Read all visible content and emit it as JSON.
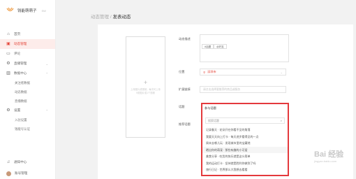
{
  "app": {
    "title": "钱能萌萌子",
    "badge": "SW"
  },
  "sidebar": {
    "items": [
      {
        "label": "首页",
        "icon": "home-icon"
      },
      {
        "label": "动态管理",
        "icon": "camera-icon"
      },
      {
        "label": "评论",
        "icon": "comment-icon"
      },
      {
        "label": "直播管理",
        "icon": "gear-icon"
      },
      {
        "label": "数据中心",
        "icon": "chart-icon"
      }
    ],
    "data_sub": [
      "关注者数据",
      "动态数据",
      "直播数据"
    ],
    "settings": {
      "label": "设置",
      "icon": "gear-icon"
    },
    "settings_sub": [
      "入驻设置",
      "钱能号认证"
    ],
    "bottom": [
      {
        "label": "通知中心",
        "icon": "bell-icon"
      },
      {
        "label": "账号管理",
        "icon": "avatar"
      }
    ]
  },
  "breadcrumb": {
    "parent": "动态管理",
    "separator": "/",
    "current": "发表动态"
  },
  "upload": {
    "plus": "+",
    "hint": "上传图片或视频，每次可上传9张图片或1个视频"
  },
  "form": {
    "desc_label": "动态描述",
    "tag_button_1": "#话题",
    "tag_button_2": "@好友",
    "location_label": "位置",
    "location_value": "深圳市",
    "extended_label": "扩展链接",
    "extended_placeholder": "请点击选择要推荐的商品或服务",
    "topic_label": "话题",
    "related_label": "推荐话题"
  },
  "dropdown": {
    "title": "参与话题",
    "search_placeholder": "搜索话题",
    "options": [
      "记录春天 · 花朵开在你看不见的角落",
      "我要天天向上打卡 · 每天进步看得见的一点",
      "周末去哪儿玩 · 发现城市里的宝藏地",
      "晒出你的萌宠 · 那些有趣的小可爱",
      "美食分享 · 吃货的快乐就是这么简单",
      "我的运动打卡 · 坚持就是胜利你做到了吗",
      "旅行日记 · 世界那么大我想去看看"
    ]
  },
  "watermark": {
    "text": "Bai 经验",
    "sub": "jingyan.baidu.com"
  },
  "colors": {
    "accent": "#e4483c",
    "highlight_border": "#e4393c"
  }
}
